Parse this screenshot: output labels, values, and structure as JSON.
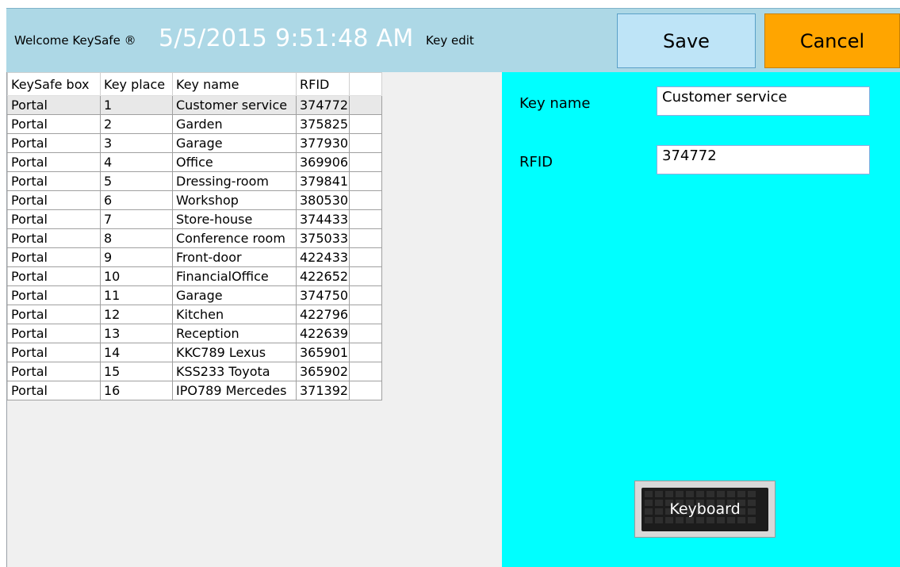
{
  "header": {
    "welcome": "Welcome KeySafe ®",
    "datetime": "5/5/2015 9:51:48 AM",
    "mode": "Key edit",
    "save_label": "Save",
    "cancel_label": "Cancel"
  },
  "table": {
    "columns": [
      "KeySafe box",
      "Key place",
      "Key name",
      "RFID",
      ""
    ],
    "rows": [
      [
        "Portal",
        "1",
        "Customer service",
        "374772"
      ],
      [
        "Portal",
        "2",
        "Garden",
        "375825"
      ],
      [
        "Portal",
        "3",
        "Garage",
        "377930"
      ],
      [
        "Portal",
        "4",
        "Office",
        "369906"
      ],
      [
        "Portal",
        "5",
        "Dressing-room",
        "379841"
      ],
      [
        "Portal",
        "6",
        "Workshop",
        "380530"
      ],
      [
        "Portal",
        "7",
        "Store-house",
        "374433"
      ],
      [
        "Portal",
        "8",
        "Conference room",
        "375033"
      ],
      [
        "Portal",
        "9",
        "Front-door",
        "422433"
      ],
      [
        "Portal",
        "10",
        "FinancialOffice",
        "422652"
      ],
      [
        "Portal",
        "11",
        "Garage",
        "374750"
      ],
      [
        "Portal",
        "12",
        "Kitchen",
        "422796"
      ],
      [
        "Portal",
        "13",
        "Reception",
        "422639"
      ],
      [
        "Portal",
        "14",
        "KKC789 Lexus",
        "365901"
      ],
      [
        "Portal",
        "15",
        "KSS233 Toyota",
        "365902"
      ],
      [
        "Portal",
        "16",
        "IPO789 Mercedes",
        "371392"
      ]
    ],
    "selected_row": 0
  },
  "edit": {
    "key_name_label": "Key name",
    "key_name_value": "Customer service",
    "rfid_label": "RFID",
    "rfid_value": "374772",
    "keyboard_label": "Keyboard"
  },
  "colors": {
    "header_bg": "#add8e6",
    "save_bg": "#bee4f7",
    "cancel_bg": "#ffa500",
    "edit_panel_bg": "#00ffff"
  }
}
